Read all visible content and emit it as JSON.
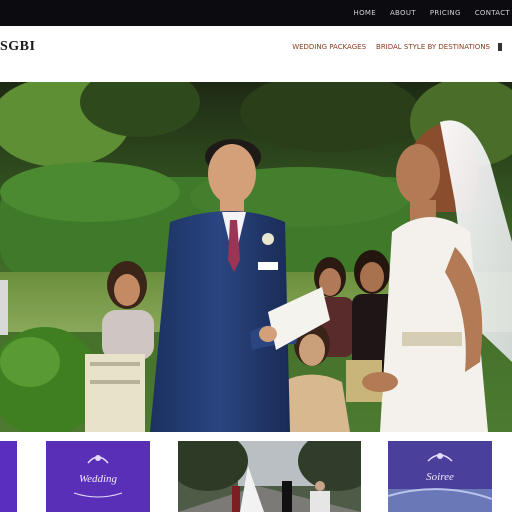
{
  "topbar": {
    "links": [
      "HOME",
      "ABOUT",
      "PRICING",
      "CONTACT"
    ]
  },
  "header": {
    "logo": "SGBI",
    "nav": [
      "WEDDING PACKAGES",
      "BRIDAL STYLE BY DESTINATIONS"
    ]
  },
  "thumbnails": [
    {
      "label": ""
    },
    {
      "label": "Wedding"
    },
    {
      "label": ""
    },
    {
      "label": "Soiree"
    }
  ]
}
